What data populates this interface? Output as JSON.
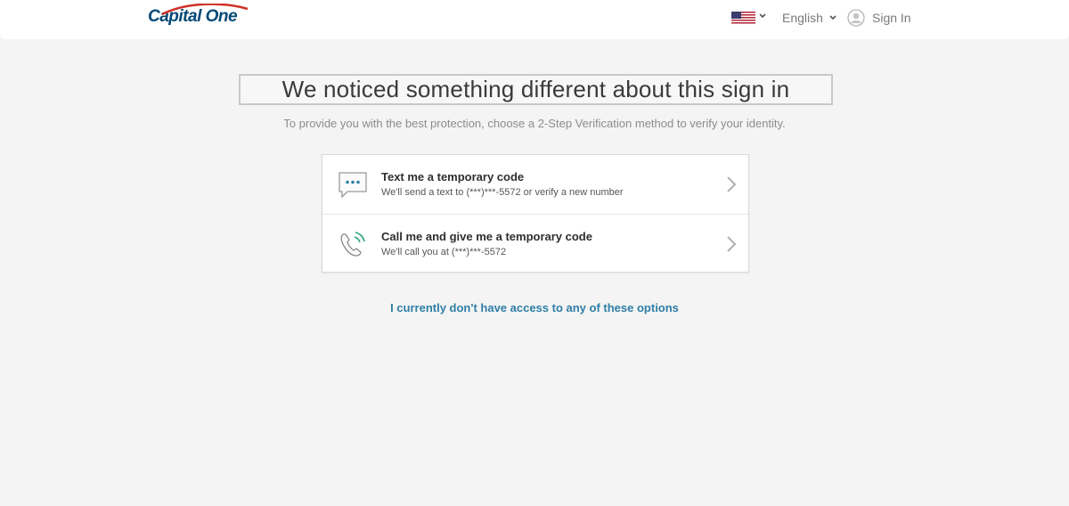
{
  "header": {
    "logo_text": "Capital One",
    "language": {
      "flag_icon": "us-flag-icon",
      "selected": "English"
    },
    "signin_label": "Sign In"
  },
  "main": {
    "headline": "We noticed something different about this sign in",
    "subtext": "To provide you with the best protection, choose a 2-Step Verification method to verify your identity.",
    "options": [
      {
        "icon": "chat-bubble-icon",
        "title": "Text me a temporary code",
        "description": "We'll send a text to (***)***-5572 or verify a new number"
      },
      {
        "icon": "phone-call-icon",
        "title": "Call me and give me a temporary code",
        "description": "We'll call you at (***)***-5572"
      }
    ],
    "no_access_link": "I currently don't have access to any of these options"
  },
  "colors": {
    "brand_blue": "#004977",
    "brand_red": "#d03027",
    "link_blue": "#2f7ea6",
    "icon_accent": "#2aa37f",
    "background": "#f4f4f4"
  }
}
